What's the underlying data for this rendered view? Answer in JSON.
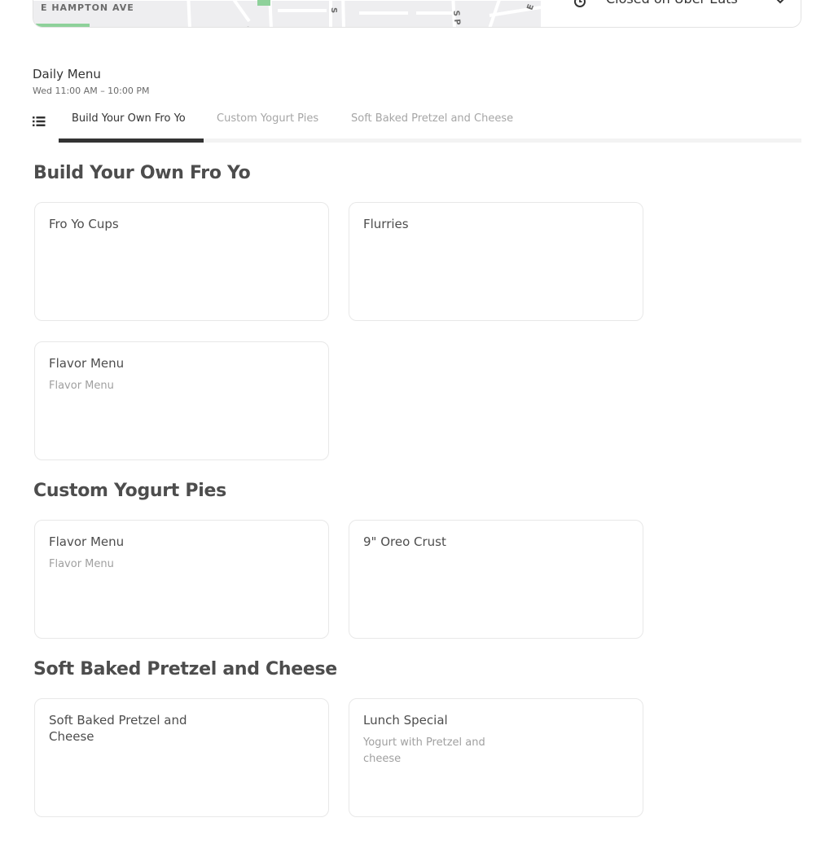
{
  "map": {
    "street_label": "E HAMPTON AVE"
  },
  "hours_panel": {
    "status": "Closed on Uber Eats",
    "clock_icon": "clock-icon",
    "chevron_icon": "chevron-down-icon"
  },
  "menu": {
    "title": "Daily Menu",
    "hours": "Wed 11:00 AM – 10:00 PM"
  },
  "tabs": [
    {
      "label": "Build Your Own Fro Yo",
      "active": true
    },
    {
      "label": "Custom Yogurt Pies",
      "active": false
    },
    {
      "label": "Soft Baked Pretzel and Cheese",
      "active": false
    }
  ],
  "sections": [
    {
      "title": "Build Your Own Fro Yo",
      "items": [
        {
          "name": "Fro Yo Cups",
          "description": ""
        },
        {
          "name": "Flurries",
          "description": ""
        },
        {
          "name": "Flavor Menu",
          "description": "Flavor Menu"
        }
      ]
    },
    {
      "title": "Custom Yogurt Pies",
      "items": [
        {
          "name": "Flavor Menu",
          "description": "Flavor Menu"
        },
        {
          "name": "9\" Oreo Crust",
          "description": ""
        }
      ]
    },
    {
      "title": "Soft Baked Pretzel and Cheese",
      "items": [
        {
          "name": "Soft Baked Pretzel and Cheese",
          "description": ""
        },
        {
          "name": "Lunch Special",
          "description": "Yogurt with Pretzel and cheese"
        }
      ]
    }
  ],
  "colors": {
    "text_primary": "#333333",
    "text_secondary": "#a6a6a6",
    "map_background": "#eeeef0",
    "map_park": "#8ed19a"
  }
}
